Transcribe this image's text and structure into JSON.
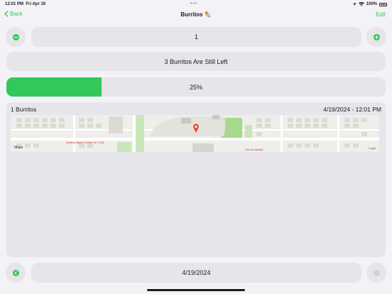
{
  "status_bar": {
    "time": "12:01 PM",
    "date": "Fri Apr 19",
    "battery": "100%"
  },
  "nav": {
    "back_label": "Back",
    "title": "Burritos 🌯",
    "edit_label": "Edit"
  },
  "counter": {
    "value": "1"
  },
  "remaining": {
    "text": "3 Burritos Are Still Left"
  },
  "progress": {
    "label": "25%",
    "fraction": 0.25,
    "color": "#34c759"
  },
  "entry": {
    "title": "1 Burritos",
    "timestamp": "4/19/2024 - 12:01 PM",
    "map": {
      "attribution": "Maps",
      "legal": "Legal",
      "places": [
        "Andrew Ayers Center for TCM",
        "Lincoln Middle"
      ]
    }
  },
  "date_nav": {
    "date": "4/19/2024"
  },
  "colors": {
    "accent": "#34c759",
    "background": "#f2f2f7",
    "control": "#e5e5ea"
  }
}
